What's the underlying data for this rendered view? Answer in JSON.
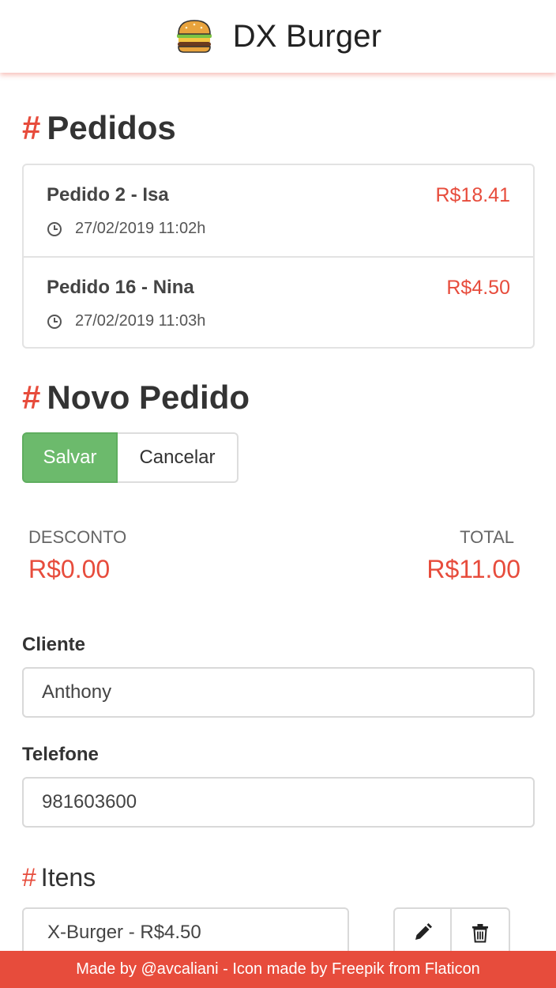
{
  "header": {
    "title": "DX Burger",
    "logo_icon": "burger-icon"
  },
  "orders_section": {
    "hash": "#",
    "title": "Pedidos",
    "orders": [
      {
        "title": "Pedido 2 - Isa",
        "price": "R$18.41",
        "time": "27/02/2019 11:02h"
      },
      {
        "title": "Pedido 16 - Nina",
        "price": "R$4.50",
        "time": "27/02/2019 11:03h"
      }
    ]
  },
  "new_order": {
    "hash": "#",
    "title": "Novo Pedido",
    "save_label": "Salvar",
    "cancel_label": "Cancelar",
    "discount_label": "DESCONTO",
    "discount_value": "R$0.00",
    "total_label": "TOTAL",
    "total_value": "R$11.00",
    "client_label": "Cliente",
    "client_value": "Anthony",
    "phone_label": "Telefone",
    "phone_value": "981603600"
  },
  "items_section": {
    "hash": "#",
    "title": "Itens",
    "items": [
      {
        "label": "X-Burger - R$4.50"
      }
    ]
  },
  "footer": {
    "text": "Made by @avcaliani - Icon made by Freepik from Flaticon"
  },
  "colors": {
    "accent": "#e74c3c",
    "save": "#6cba6c",
    "text": "#333333"
  }
}
